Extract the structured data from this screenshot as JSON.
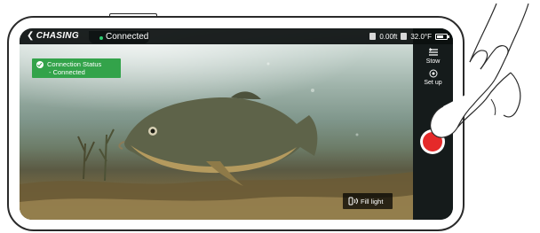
{
  "app": {
    "brand": "CHASING",
    "connection_label": "Connected",
    "depth": "0.00ft",
    "temperature": "32.0°F"
  },
  "notification": {
    "title": "Connection Status",
    "subtitle": "- Connected",
    "color": "#33a34a"
  },
  "side_controls": {
    "stow_label": "Stow",
    "setup_label": "Set up",
    "record_color": "#e52a2a"
  },
  "fill_light": {
    "label": "Fill light"
  },
  "icons": [
    "back-chevron-icon",
    "depth-icon",
    "thermometer-icon",
    "battery-icon",
    "check-circle-icon",
    "stow-icon",
    "settings-icon",
    "record-icon",
    "flashlight-icon"
  ]
}
